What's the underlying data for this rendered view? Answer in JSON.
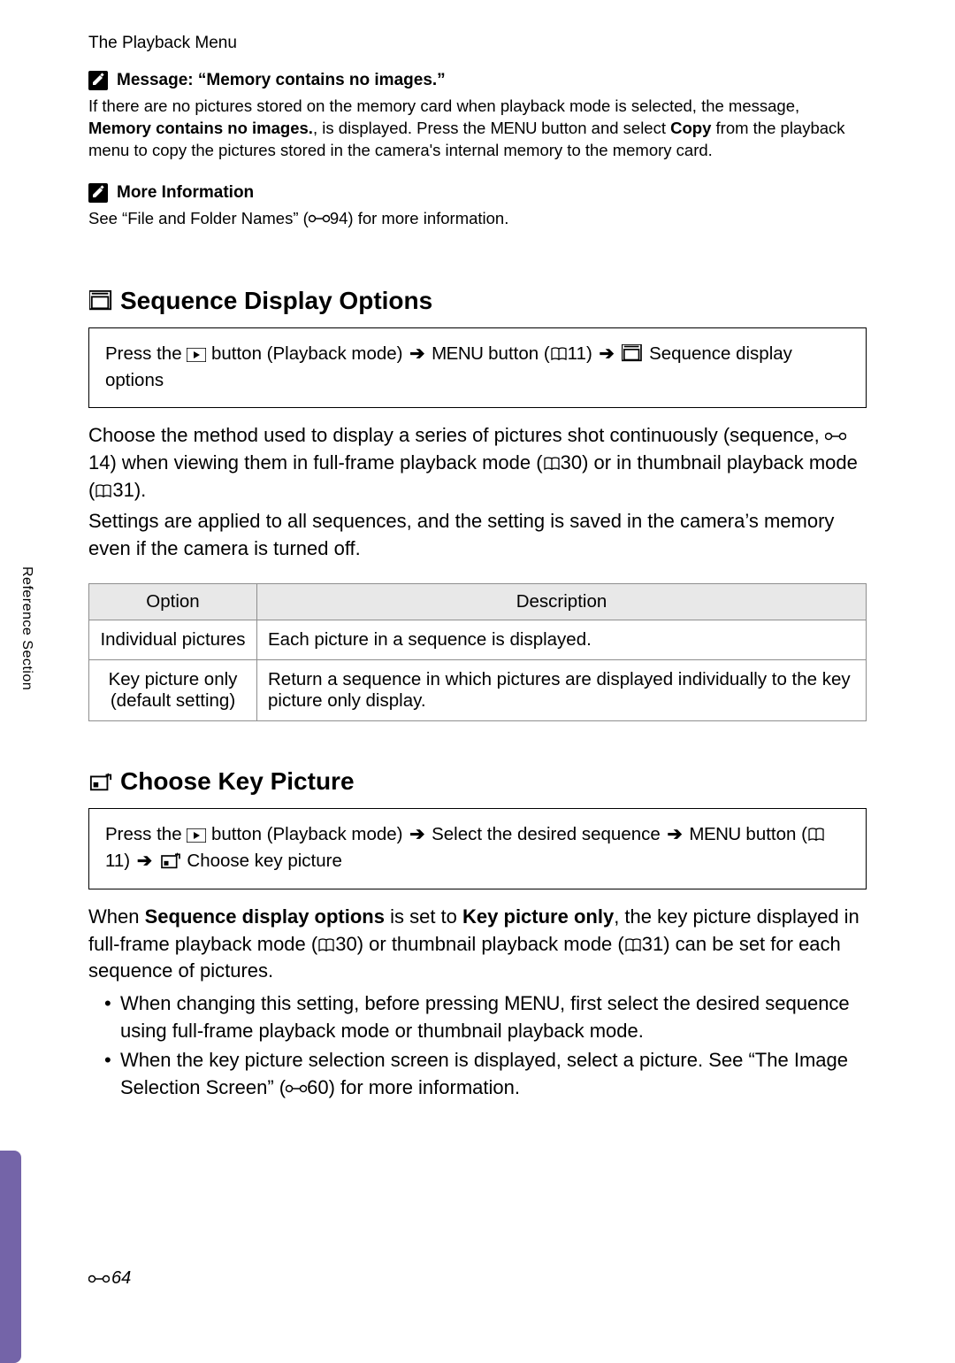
{
  "section_label": "The Playback Menu",
  "note1": {
    "title": "Message: “Memory contains no images.”",
    "body_1": "If there are no pictures stored on the memory card when playback mode is selected, the message, ",
    "bold_1": "Memory contains no images.",
    "mid_1": ", is displayed. Press the ",
    "menu": "MENU",
    "mid_2": " button and select ",
    "bold_2": "Copy",
    "end": " from the playback menu to copy the pictures stored in the camera's internal memory to the memory card."
  },
  "note2": {
    "title": "More Information",
    "body_pre": "See “File and Folder Names” (",
    "ref": "94",
    "body_post": ") for more information."
  },
  "heading1": "Sequence Display Options",
  "nav1": {
    "p1": "Press the ",
    "p2": " button (Playback mode) ",
    "p3": " ",
    "menu": "MENU",
    "p4": " button (",
    "ref11": "11",
    "p5": ") ",
    "p6": " ",
    "p7": " Sequence display options"
  },
  "body1_a": "Choose the method used to display a series of pictures shot continuously (sequence, ",
  "body1_ref1": "14",
  "body1_b": ") when viewing them in full-frame playback mode (",
  "body1_ref2": "30",
  "body1_c": ") or in thumbnail playback mode (",
  "body1_ref3": "31",
  "body1_d": ").",
  "body2": "Settings are applied to all sequences, and the setting is saved in the camera’s memory even if the camera is turned off.",
  "table": {
    "h1": "Option",
    "h2": "Description",
    "rows": [
      {
        "opt": "Individual pictures",
        "desc": "Each picture in a sequence is displayed."
      },
      {
        "opt": "Key picture only (default setting)",
        "desc": "Return a sequence in which pictures are displayed individually to the key picture only display."
      }
    ]
  },
  "heading2": "Choose Key Picture",
  "nav2": {
    "p1": "Press the ",
    "p2": " button (Playback mode) ",
    "p3": " Select the desired sequence ",
    "p4": " ",
    "menu": "MENU",
    "p5": " button (",
    "ref11": "11",
    "p6": ") ",
    "p7": " ",
    "p8": " Choose key picture"
  },
  "body3_a": "When ",
  "body3_bold1": "Sequence display options",
  "body3_b": " is set to ",
  "body3_bold2": "Key picture only",
  "body3_c": ", the key picture displayed in full-frame playback mode (",
  "body3_ref1": "30",
  "body3_d": ") or thumbnail playback mode (",
  "body3_ref2": "31",
  "body3_e": ") can be set for each sequence of pictures.",
  "bullets": [
    {
      "a": "When changing this setting, before pressing ",
      "menu": "MENU",
      "b": ", first select the desired sequence using full-frame playback mode or thumbnail playback mode."
    },
    {
      "a": "When the key picture selection screen is displayed, select a picture. See “The Image Selection Screen” (",
      "ref": "60",
      "b": ") for more information."
    }
  ],
  "side_tab": "Reference Section",
  "page_number": "64"
}
